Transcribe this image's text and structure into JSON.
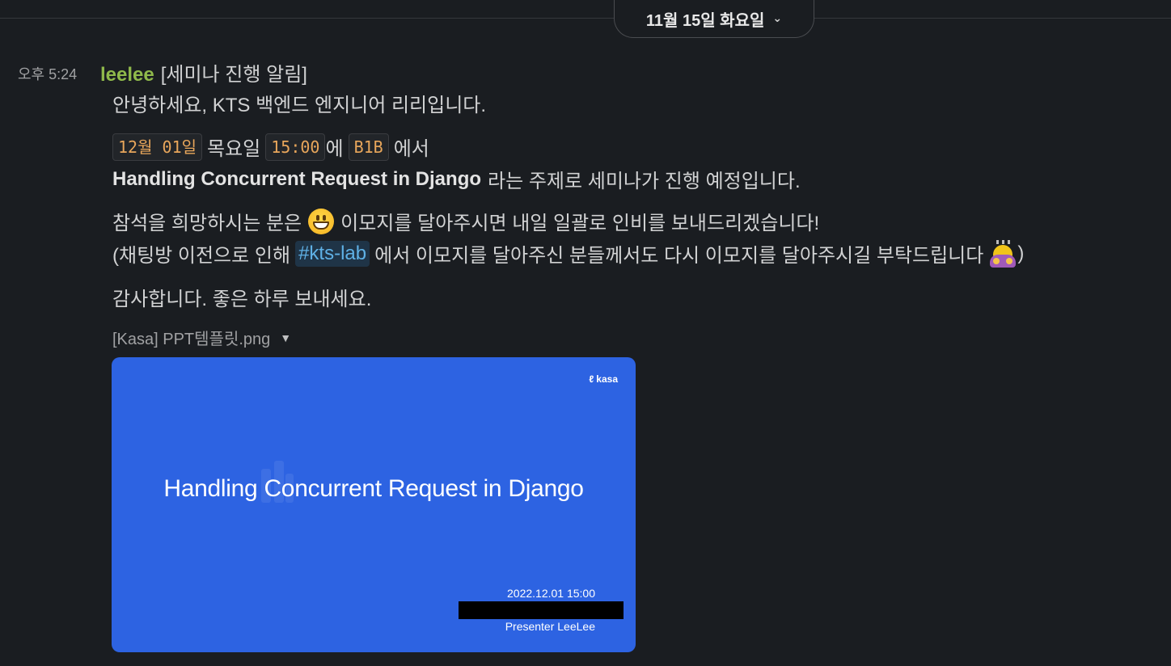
{
  "day_divider": {
    "label": "11월 15일 화요일",
    "chevron": "chevron-down-icon"
  },
  "message": {
    "timestamp": "오후 5:24",
    "sender": "leelee",
    "first_line": "[세미나 진행 알림]",
    "greeting": "안녕하세요, KTS 백엔드 엔지니어 리리입니다.",
    "date_code": "12월 01일",
    "weekday": "목요일",
    "time_code": "15:00",
    "time_suffix": "에",
    "room_code": "B1B",
    "room_suffix": "에서",
    "topic_bold": "Handling Concurrent Request in Django",
    "topic_suffix": "라는 주제로 세미나가 진행 예정입니다.",
    "rsvp_prefix": "참석을 희망하시는 분은",
    "rsvp_emoji": "grinning-face-emoji",
    "rsvp_suffix": "이모지를 달아주시면 내일 일괄로 인비를 보내드리겠습니다!",
    "note_prefix": "(채팅방 이전으로 인해",
    "channel": "#kts-lab",
    "note_suffix": "에서 이모지를 달아주신 분들께서도 다시 이모지를 달아주시길 부탁드립니다",
    "note_emoji": "person-bowing-emoji",
    "note_close": ")",
    "closing": "감사합니다. 좋은 하루 보내세요."
  },
  "attachment": {
    "file_name": "[Kasa] PPT템플릿.png",
    "slide": {
      "logo": "kasa",
      "title": "Handling Concurrent Request in Django",
      "date": "2022.12.01 15:00",
      "presenter": "Presenter LeeLee"
    }
  },
  "colors": {
    "background": "#1a1d21",
    "sender": "#8fb94b",
    "code_text": "#e8a65b",
    "channel_text": "#5fb1e6",
    "slide_bg": "#2d63e2"
  }
}
